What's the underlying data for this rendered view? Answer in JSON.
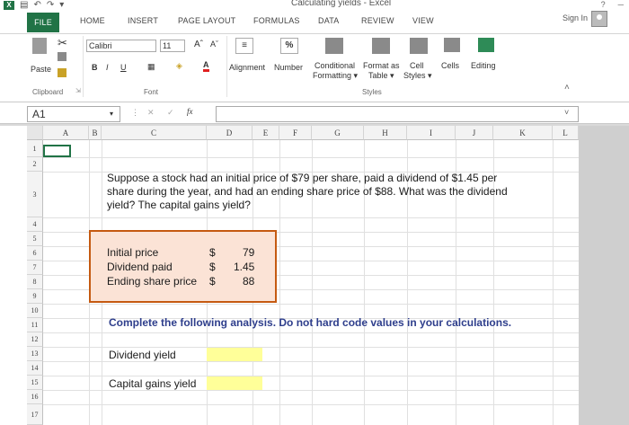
{
  "window": {
    "title": "Calculating yields - Excel"
  },
  "account": {
    "signin": "Sign In"
  },
  "tabs": [
    "FILE",
    "HOME",
    "INSERT",
    "PAGE LAYOUT",
    "FORMULAS",
    "DATA",
    "REVIEW",
    "VIEW"
  ],
  "ribbon": {
    "clipboard": {
      "paste": "Paste",
      "label": "Clipboard"
    },
    "font": {
      "name": "Calibri",
      "size": "11",
      "bold": "B",
      "italic": "I",
      "underline": "U",
      "label": "Font",
      "grow": "Aˆ",
      "shrink": "Aˇ"
    },
    "alignment": {
      "label": "Alignment"
    },
    "number": {
      "label": "Number",
      "symbol": "%"
    },
    "styles": {
      "conditional": "Conditional",
      "conditional2": "Formatting ▾",
      "format_as": "Format as",
      "format_as2": "Table ▾",
      "cell": "Cell",
      "cell2": "Styles ▾",
      "label": "Styles"
    },
    "cells": {
      "label": "Cells"
    },
    "editing": {
      "label": "Editing"
    }
  },
  "formula_bar": {
    "name_box": "A1",
    "fx": "fx",
    "value": ""
  },
  "grid": {
    "columns": [
      "A",
      "B",
      "C",
      "D",
      "E",
      "F",
      "G",
      "H",
      "I",
      "J",
      "K",
      "L"
    ],
    "rows": [
      "1",
      "2",
      "3",
      "4",
      "5",
      "6",
      "7",
      "8",
      "9",
      "10",
      "11",
      "12",
      "13",
      "14",
      "15",
      "16",
      "17"
    ]
  },
  "content": {
    "question_l1": "Suppose a stock had an initial price of $79 per share, paid a dividend of $1.45 per",
    "question_l2": "share during the year, and had an ending share price of $88. What was the dividend",
    "question_l3": "yield? The capital gains yield?",
    "inputs": [
      {
        "label": "Initial price",
        "currency": "$",
        "value": "79"
      },
      {
        "label": "Dividend paid",
        "currency": "$",
        "value": "1.45"
      },
      {
        "label": "Ending share price",
        "currency": "$",
        "value": "88"
      }
    ],
    "instruction": "Complete the following analysis. Do not hard code values in your calculations.",
    "outputs": [
      {
        "label": "Dividend yield",
        "value": ""
      },
      {
        "label": "Capital gains yield",
        "value": ""
      }
    ]
  }
}
